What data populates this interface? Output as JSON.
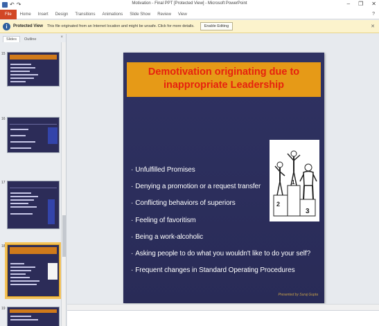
{
  "titlebar": {
    "title": "Motivation - Final PPT [Protected View] - Microsoft PowerPoint",
    "icons": [
      "save-icon",
      "undo-icon",
      "redo-icon"
    ],
    "window_controls": [
      "–",
      "❐",
      "✕"
    ]
  },
  "ribbon": {
    "file_tab": "File",
    "tabs": [
      "Home",
      "Insert",
      "Design",
      "Transitions",
      "Animations",
      "Slide Show",
      "Review",
      "View"
    ]
  },
  "protected_view": {
    "title": "Protected View",
    "message": "This file originated from an Internet location and might be unsafe. Click for more details.",
    "button": "Enable Editing"
  },
  "left_panel": {
    "tabs": [
      "Slides",
      "Outline"
    ],
    "close": "×",
    "thumbnails": [
      {
        "number": "15"
      },
      {
        "number": "16"
      },
      {
        "number": "17"
      },
      {
        "number": "18",
        "selected": true
      },
      {
        "number": "19"
      }
    ]
  },
  "slide": {
    "title": "Demotivation originating due to inappropriate Leadership",
    "bullets": [
      "Unfulfilled Promises",
      "Denying a promotion or a request transfer",
      "Conflicting behaviors of superiors",
      "Feeling of favoritism",
      "Being a work-alcoholic",
      "Asking people to do what you wouldn't like to do your self?",
      "Frequent changes in Standard Operating Procedures"
    ],
    "footer": "Presented by Suraj Gupta",
    "podium_labels": [
      "1",
      "2",
      "3"
    ]
  },
  "colors": {
    "slide_bg": "#2a2d5c",
    "title_band": "#e69a17",
    "title_text": "#e6220f",
    "protected_bar": "#fcf3cc",
    "file_tab": "#d24726"
  }
}
